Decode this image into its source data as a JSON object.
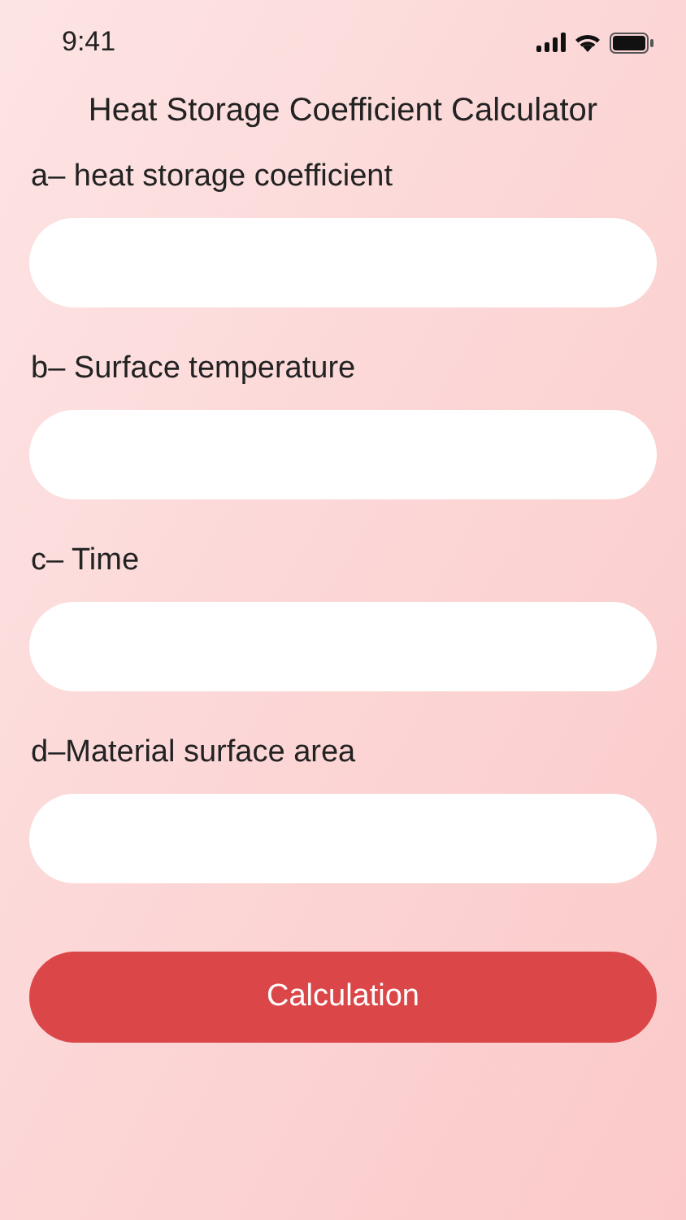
{
  "status_bar": {
    "time": "9:41"
  },
  "title": "Heat Storage Coefficient Calculator",
  "fields": [
    {
      "label": "a– heat storage coefficient"
    },
    {
      "label": "b– Surface temperature"
    },
    {
      "label": "c– Time"
    },
    {
      "label": "d–Material surface area"
    }
  ],
  "button": "Calculation"
}
